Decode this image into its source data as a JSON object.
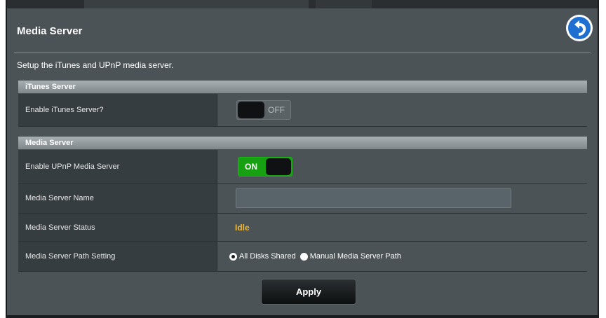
{
  "header": {
    "title": "Media Server",
    "back_icon": "back-arrow-icon"
  },
  "description": "Setup the iTunes and UPnP media server.",
  "itunes_section": {
    "header": "iTunes Server",
    "enable_label": "Enable iTunes Server?",
    "enable_toggle": "OFF"
  },
  "media_section": {
    "header": "Media Server",
    "upnp_label": "Enable UPnP Media Server",
    "upnp_toggle": "ON",
    "name_label": "Media Server Name",
    "name_value": "",
    "status_label": "Media Server Status",
    "status_value": "Idle",
    "path_label": "Media Server Path Setting",
    "path_options": [
      "All Disks Shared",
      "Manual Media Server Path"
    ],
    "path_selected": "All Disks Shared"
  },
  "actions": {
    "apply_label": "Apply"
  },
  "colors": {
    "panel_bg": "#4c5356",
    "label_bg": "#363d41",
    "toggle_on": "#16a012",
    "status_idle": "#f1b82b",
    "back_button": "#1e6fd0"
  }
}
